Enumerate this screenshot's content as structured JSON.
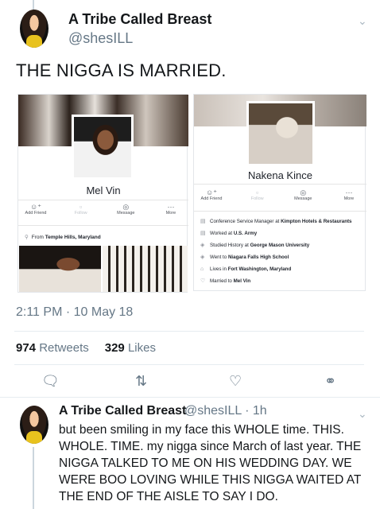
{
  "tweet": {
    "display_name": "A Tribe Called Breast",
    "handle": "@shesILL",
    "text": "THE NIGGA IS MARRIED.",
    "timestamp": "2:11 PM · 10 May 18",
    "stats": {
      "retweets_count": "974",
      "retweets_label": "Retweets",
      "likes_count": "329",
      "likes_label": "Likes"
    },
    "actions": {
      "reply_icon": "reply-icon",
      "retweet_icon": "retweet-icon",
      "like_icon": "heart-icon",
      "share_icon": "share-icon"
    }
  },
  "left_profile": {
    "name": "Mel Vin",
    "actions": [
      "Add Friend",
      "Follow",
      "Message",
      "More"
    ],
    "from_prefix": "From",
    "from_place": "Temple Hills, Maryland"
  },
  "right_profile": {
    "name": "Nakena Kince",
    "actions": [
      "Add Friend",
      "Follow",
      "Message",
      "More"
    ],
    "info": [
      {
        "prefix": "Conference Service Manager at",
        "bold": "Kimpton Hotels & Restaurants"
      },
      {
        "prefix": "Worked at",
        "bold": "U.S. Army"
      },
      {
        "prefix": "Studied History at",
        "bold": "George Mason University"
      },
      {
        "prefix": "Went to",
        "bold": "Niagara Falls High School"
      },
      {
        "prefix": "Lives in",
        "bold": "Fort Washington, Maryland"
      },
      {
        "prefix": "Married to",
        "bold": "Mel Vin"
      }
    ]
  },
  "reply": {
    "display_name": "A Tribe Called Breast",
    "handle_time": "@shesILL · 1h",
    "text": "but been smiling in my face this WHOLE time. THIS. WHOLE. TIME. my nigga since March of last year. THE NIGGA TALKED TO ME ON HIS WEDDING DAY. WE WERE BOO LOVING WHILE THIS NIGGA WAITED AT THE END OF THE AISLE TO SAY I DO."
  },
  "colors": {
    "text": "#14171a",
    "muted": "#657786",
    "divider": "#e6ecf0"
  }
}
